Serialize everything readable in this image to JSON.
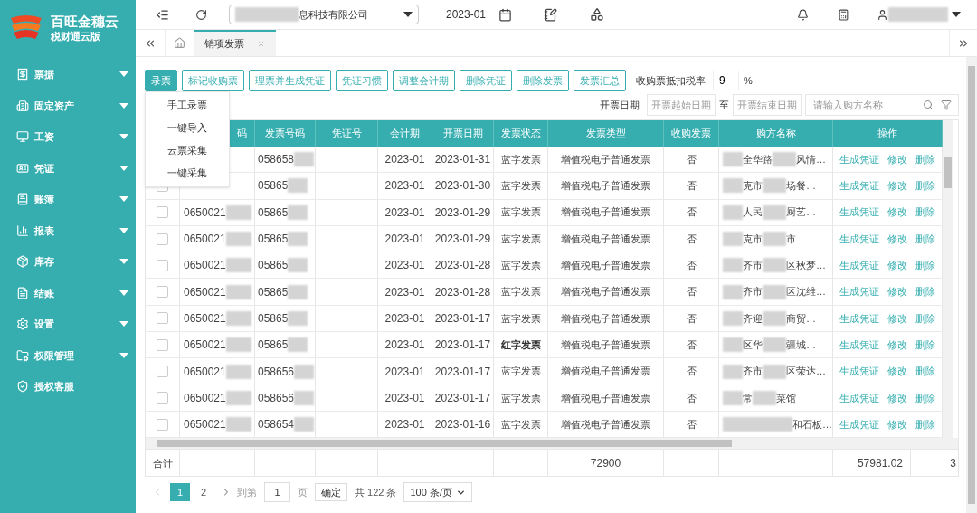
{
  "brand": {
    "name": "百旺金穗云",
    "edition": "税财通云版"
  },
  "sidebar": {
    "items": [
      {
        "label": "票据",
        "expandable": true
      },
      {
        "label": "固定资产",
        "expandable": true
      },
      {
        "label": "工资",
        "expandable": true
      },
      {
        "label": "凭证",
        "expandable": true
      },
      {
        "label": "账簿",
        "expandable": true
      },
      {
        "label": "报表",
        "expandable": true
      },
      {
        "label": "库存",
        "expandable": true
      },
      {
        "label": "结账",
        "expandable": true
      },
      {
        "label": "设置",
        "expandable": true
      },
      {
        "label": "权限管理",
        "expandable": true
      },
      {
        "label": "授权客服",
        "expandable": false
      }
    ]
  },
  "topbar": {
    "company": "息科技有限公司",
    "period": "2023-01"
  },
  "tabs": [
    {
      "label": "销项发票",
      "selected": true
    }
  ],
  "toolbar": {
    "buttons": [
      {
        "label": "录票",
        "primary": true
      },
      {
        "label": "标记收购票",
        "primary": false
      },
      {
        "label": "理票并生成凭证",
        "primary": false
      },
      {
        "label": "凭证习惯",
        "primary": false
      },
      {
        "label": "调整会计期",
        "primary": false
      },
      {
        "label": "删除凭证",
        "primary": false
      },
      {
        "label": "删除发票",
        "primary": false
      },
      {
        "label": "发票汇总",
        "primary": false
      }
    ],
    "rate_label": "收购票抵扣税率:",
    "rate_value": "9",
    "rate_unit": "%"
  },
  "dropdown": [
    "手工录票",
    "一键导入",
    "云票采集",
    "一键采集"
  ],
  "filters": {
    "date_label": "开票日期",
    "start_placeholder": "开票起始日期",
    "separator": "至",
    "end_placeholder": "开票结束日期",
    "search_placeholder": "请输入购方名称"
  },
  "table": {
    "columns": [
      "码",
      "发票号码",
      "凭证号",
      "会计期",
      "开票日期",
      "发票状态",
      "发票类型",
      "收购发票",
      "购方名称",
      "操作"
    ],
    "rows": [
      {
        "number": "058658",
        "period": "2023-01",
        "date": "2023-01-31",
        "status": "蓝字发票",
        "red": false,
        "type": "增值税电子普通发票",
        "purchase": "否",
        "buyer": [
          "全华路",
          "风情…"
        ],
        "actions": [
          "生成凭证",
          "修改",
          "删除"
        ]
      },
      {
        "number": "05865",
        "period": "2023-01",
        "date": "2023-01-30",
        "status": "蓝字发票",
        "red": false,
        "type": "增值税电子普通发票",
        "purchase": "否",
        "buyer": [
          "克市",
          "场餐…"
        ],
        "checked": false,
        "actions": [
          "生成凭证",
          "修改",
          "删除"
        ]
      },
      {
        "code": "0650021",
        "number": "05865",
        "period": "2023-01",
        "date": "2023-01-29",
        "status": "蓝字发票",
        "red": false,
        "type": "增值税电子普通发票",
        "purchase": "否",
        "buyer": [
          "人民",
          "厨艺…"
        ],
        "checked": false,
        "actions": [
          "生成凭证",
          "修改",
          "删除"
        ]
      },
      {
        "code": "0650021",
        "number": "05865",
        "period": "2023-01",
        "date": "2023-01-29",
        "status": "蓝字发票",
        "red": false,
        "type": "增值税电子普通发票",
        "purchase": "否",
        "buyer": [
          "克市",
          "市"
        ],
        "checked": false,
        "actions": [
          "生成凭证",
          "修改",
          "删除"
        ]
      },
      {
        "code": "0650021",
        "number": "05865",
        "period": "2023-01",
        "date": "2023-01-28",
        "status": "蓝字发票",
        "red": false,
        "type": "增值税电子普通发票",
        "purchase": "否",
        "buyer": [
          "齐市",
          "区秋梦…"
        ],
        "checked": false,
        "actions": [
          "生成凭证",
          "修改",
          "删除"
        ]
      },
      {
        "code": "0650021",
        "number": "05865",
        "period": "2023-01",
        "date": "2023-01-28",
        "status": "蓝字发票",
        "red": false,
        "type": "增值税电子普通发票",
        "purchase": "否",
        "buyer": [
          "齐市",
          "区沈维…"
        ],
        "checked": false,
        "actions": [
          "生成凭证",
          "修改",
          "删除"
        ]
      },
      {
        "code": "0650021",
        "number": "05865",
        "period": "2023-01",
        "date": "2023-01-17",
        "status": "蓝字发票",
        "red": false,
        "type": "增值税电子普通发票",
        "purchase": "否",
        "buyer": [
          "齐迎",
          "商贸…"
        ],
        "checked": false,
        "actions": [
          "生成凭证",
          "修改",
          "删除"
        ]
      },
      {
        "code": "0650021",
        "number": "05865",
        "period": "2023-01",
        "date": "2023-01-17",
        "status": "红字发票",
        "red": true,
        "type": "增值税电子普通发票",
        "purchase": "否",
        "buyer": [
          "区华",
          "疆城…"
        ],
        "checked": false,
        "actions": [
          "生成凭证",
          "修改",
          "删除"
        ]
      },
      {
        "code": "0650021",
        "number": "058656",
        "period": "2023-01",
        "date": "2023-01-17",
        "status": "蓝字发票",
        "red": false,
        "type": "增值税电子普通发票",
        "purchase": "否",
        "buyer": [
          "齐市",
          "区荣达…"
        ],
        "checked": false,
        "actions": [
          "生成凭证",
          "修改",
          "删除"
        ]
      },
      {
        "code": "0650021",
        "number": "058656",
        "period": "2023-01",
        "date": "2023-01-17",
        "status": "蓝字发票",
        "red": false,
        "type": "增值税电子普通发票",
        "purchase": "否",
        "buyer": [
          "常",
          "菜馆"
        ],
        "checked": false,
        "actions": [
          "生成凭证",
          "修改",
          "删除"
        ]
      },
      {
        "code": "0650021",
        "number": "058654",
        "period": "2023-01",
        "date": "2023-01-16",
        "status": "蓝字发票",
        "red": false,
        "type": "增值税电子普通发票",
        "purchase": "否",
        "buyer": [
          "和石板…"
        ],
        "checked": false,
        "actions": [
          "生成凭证",
          "修改",
          "删除"
        ]
      }
    ],
    "totals": {
      "label": "合计",
      "type_total": "72900",
      "action_total": "57981.02",
      "column_12": "3"
    }
  },
  "pagination": {
    "pages": [
      {
        "label": "1",
        "selected": true
      },
      {
        "label": "2",
        "selected": false
      }
    ],
    "goto_label": "到第",
    "goto_value": "1",
    "page_unit": "页",
    "confirm": "确定",
    "total": "共 122 条",
    "page_size": "100 条/页"
  }
}
